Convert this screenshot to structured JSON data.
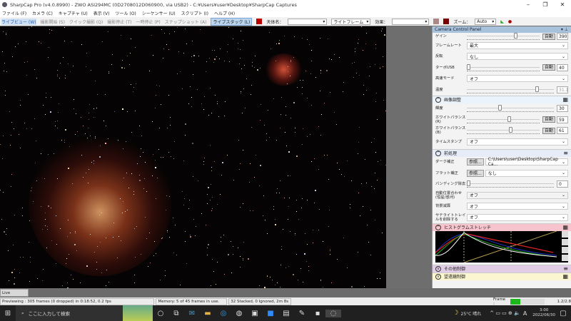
{
  "window": {
    "title": "SharpCap Pro (v4.0.8990) - ZWO ASI294MC (0D2708012D060900, via USB2) - C:¥Users¥user¥Desktop¥SharpCap Captures"
  },
  "menu": [
    "ファイル (F)",
    "カメラ (C)",
    "キャプチャ (U)",
    "表示 (V)",
    "ツール (O)",
    "シーケンサー (U)",
    "スクリプト (I)",
    "ヘルプ (H)"
  ],
  "toolbar": {
    "live_view": "ライブビュー (W)",
    "start_capture": "撮影開始 (S)",
    "quick_capture": "クイック撮影 (Q)",
    "stop_capture": "撮影停止 (T)",
    "pause": "一時停止 (P)",
    "snapshot": "スナップショット (A)",
    "live_stack": "ライブスタック (L)",
    "target_label": "天体名：",
    "target_value": "",
    "frame_type": "ライトフレーム",
    "effect_label": "効果：",
    "effect_value": "",
    "zoom_label": "ズーム：",
    "zoom_value": "Auto"
  },
  "panel": {
    "title": "Camera Control Panel",
    "camera": {
      "gain_label": "ゲイン",
      "gain_value": "390",
      "gain_fraction": 0.68,
      "auto": "自動",
      "framerate_label": "フレームレート",
      "framerate_value": "最大",
      "flip_label": "反転",
      "flip_value": "なし",
      "turbo_label": "ターボUSB",
      "turbo_value": "40",
      "turbo_fraction": 0.0,
      "highspeed_label": "高速モード",
      "highspeed_value": "オフ",
      "temp_label": "温度",
      "temp_value": "31.1",
      "temp_fraction": 0.82
    },
    "image": {
      "title": "画像調整",
      "brightness_label": "輝度",
      "brightness_value": "30",
      "brightness_fraction": 0.38,
      "wb_r_label": "ホワイトバランス(R)",
      "wb_r_value": "59",
      "wb_r_fraction": 0.59,
      "wb_b_label": "ホワイトバランス(B)",
      "wb_b_value": "61",
      "wb_b_fraction": 0.61,
      "timestamp_label": "タイムスタンプ",
      "timestamp_value": "オフ"
    },
    "pre": {
      "title": "前処理",
      "dark_label": "ダーク補正",
      "browse": "参照...",
      "dark_value": "C:\\Users\\user\\Desktop\\SharpCap Ca...",
      "flat_label": "フラット補正",
      "flat_value": "なし",
      "banding_label": "バンディング除去",
      "banding_value": "0",
      "banding_fraction": 0.0,
      "align_label": "自動位置合わせ (恒星/惑河)",
      "align_value": "オフ",
      "bg_label": "背景減算",
      "bg_value": "オフ",
      "sat_label": "サテライトトレイルを削除する",
      "sat_value": "オフ"
    },
    "hist": {
      "title": "ヒストグラムストレッチ"
    },
    "other": {
      "title": "その他制御"
    },
    "scope": {
      "title": "望遠鏡制御"
    }
  },
  "live_tab": "Live Stacking",
  "status": {
    "preview": "Previewing : 305 frames (0 dropped) in 0:18:52, 0.2 fps",
    "memory": "Memory: 5 of 45 frames in use.",
    "stacked": "32 Stacked, 0 Ignored, 2m 8s",
    "frame_label": "Frame :",
    "frame_fraction": 0.3,
    "frame_value": "1.2/2.8"
  },
  "taskbar": {
    "search": "ここに入力して検索",
    "weather": "25°C 晴れ",
    "ime": "A",
    "time": "3:00",
    "date": "2022/06/30"
  },
  "colors": {
    "accent": "#1a5fb4",
    "hist_header": "#f7c3cc",
    "other_header": "#e2cde6",
    "scope_header": "#fbf6cf"
  }
}
